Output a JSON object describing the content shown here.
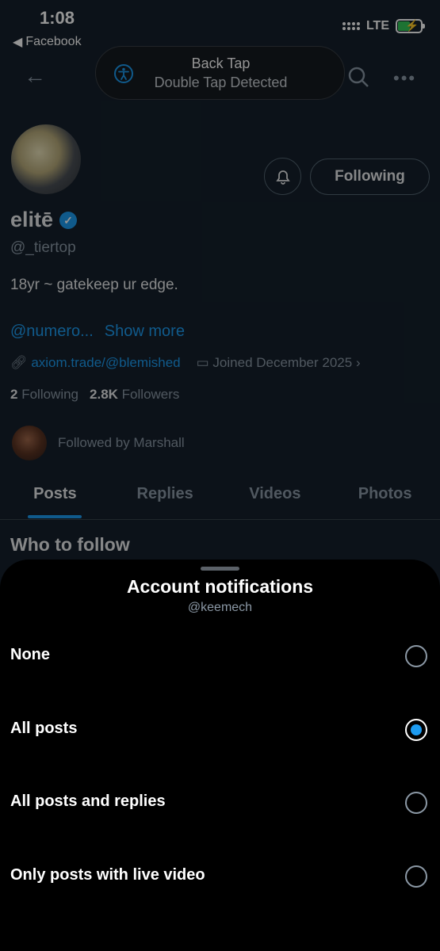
{
  "status_bar": {
    "time": "1:08",
    "back_app": "Facebook",
    "network": "LTE"
  },
  "toast": {
    "title": "Back Tap",
    "message": "Double Tap Detected"
  },
  "profile": {
    "display_name": "elitē",
    "handle": "@_tiertop",
    "bio": "18yr ~ gatekeep ur edge.",
    "mention_link": "@numero...",
    "show_more": "Show more",
    "website": "axiom.trade/@blemished",
    "joined": "Joined December 2025",
    "following_count": "2",
    "following_label": "Following",
    "followers_count": "2.8K",
    "followers_label": "Followers",
    "followed_by": "Followed by Marshall",
    "following_button": "Following"
  },
  "tabs": [
    "Posts",
    "Replies",
    "Videos",
    "Photos"
  ],
  "section_title": "Who to follow",
  "sheet": {
    "title": "Account notifications",
    "subtitle": "@keemech",
    "options": [
      {
        "label": "None",
        "selected": false
      },
      {
        "label": "All posts",
        "selected": true
      },
      {
        "label": "All posts and replies",
        "selected": false
      },
      {
        "label": "Only posts with live video",
        "selected": false
      }
    ]
  },
  "colors": {
    "accent": "#1d9bf0",
    "background": "#15202b",
    "sheet": "#000000"
  }
}
